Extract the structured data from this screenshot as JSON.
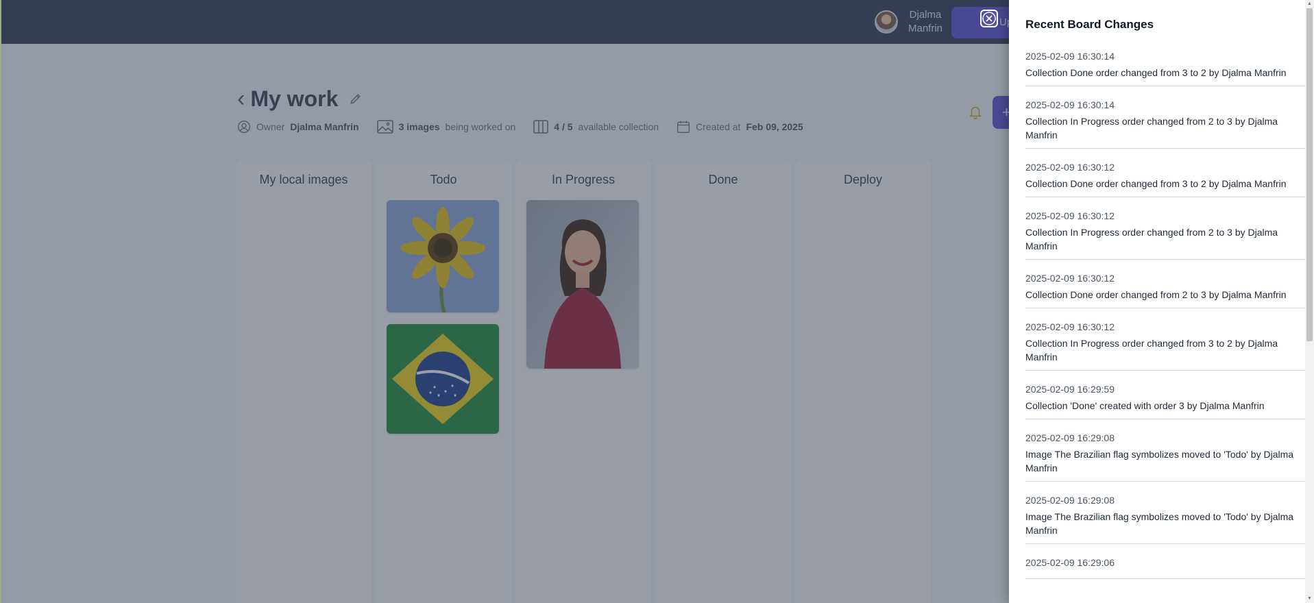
{
  "header": {
    "user_name": "Djalma Manfrin",
    "action_button_label": "Up"
  },
  "board": {
    "title": "My work",
    "owner_label": "Owner",
    "owner_name": "Djalma Manfrin",
    "images_count": "3 images",
    "images_suffix": "being worked on",
    "collections_count": "4 / 5",
    "collections_suffix": "available collection",
    "created_label": "Created at",
    "created_date": "Feb 09, 2025",
    "add_button_label": "+"
  },
  "columns": [
    {
      "title": "My local images"
    },
    {
      "title": "Todo"
    },
    {
      "title": "In Progress"
    },
    {
      "title": "Done"
    },
    {
      "title": "Deploy"
    }
  ],
  "cards": {
    "sunflower": "sunflower image",
    "flag": "Brazilian flag image",
    "woman": "portrait image"
  },
  "drawer": {
    "title": "Recent Board Changes",
    "items": [
      {
        "time": "2025-02-09 16:30:14",
        "text": "Collection Done order changed from 3 to 2 by Djalma Manfrin"
      },
      {
        "time": "2025-02-09 16:30:14",
        "text": "Collection In Progress order changed from 2 to 3 by Djalma Manfrin"
      },
      {
        "time": "2025-02-09 16:30:12",
        "text": "Collection Done order changed from 3 to 2 by Djalma Manfrin"
      },
      {
        "time": "2025-02-09 16:30:12",
        "text": "Collection In Progress order changed from 2 to 3 by Djalma Manfrin"
      },
      {
        "time": "2025-02-09 16:30:12",
        "text": "Collection Done order changed from 2 to 3 by Djalma Manfrin"
      },
      {
        "time": "2025-02-09 16:30:12",
        "text": "Collection In Progress order changed from 3 to 2 by Djalma Manfrin"
      },
      {
        "time": "2025-02-09 16:29:59",
        "text": "Collection 'Done' created with order 3 by Djalma Manfrin"
      },
      {
        "time": "2025-02-09 16:29:08",
        "text": "Image The Brazilian flag symbolizes moved to 'Todo' by Djalma Manfrin"
      },
      {
        "time": "2025-02-09 16:29:08",
        "text": "Image The Brazilian flag symbolizes moved to 'Todo' by Djalma Manfrin"
      },
      {
        "time": "2025-02-09 16:29:06",
        "text": ""
      }
    ]
  }
}
